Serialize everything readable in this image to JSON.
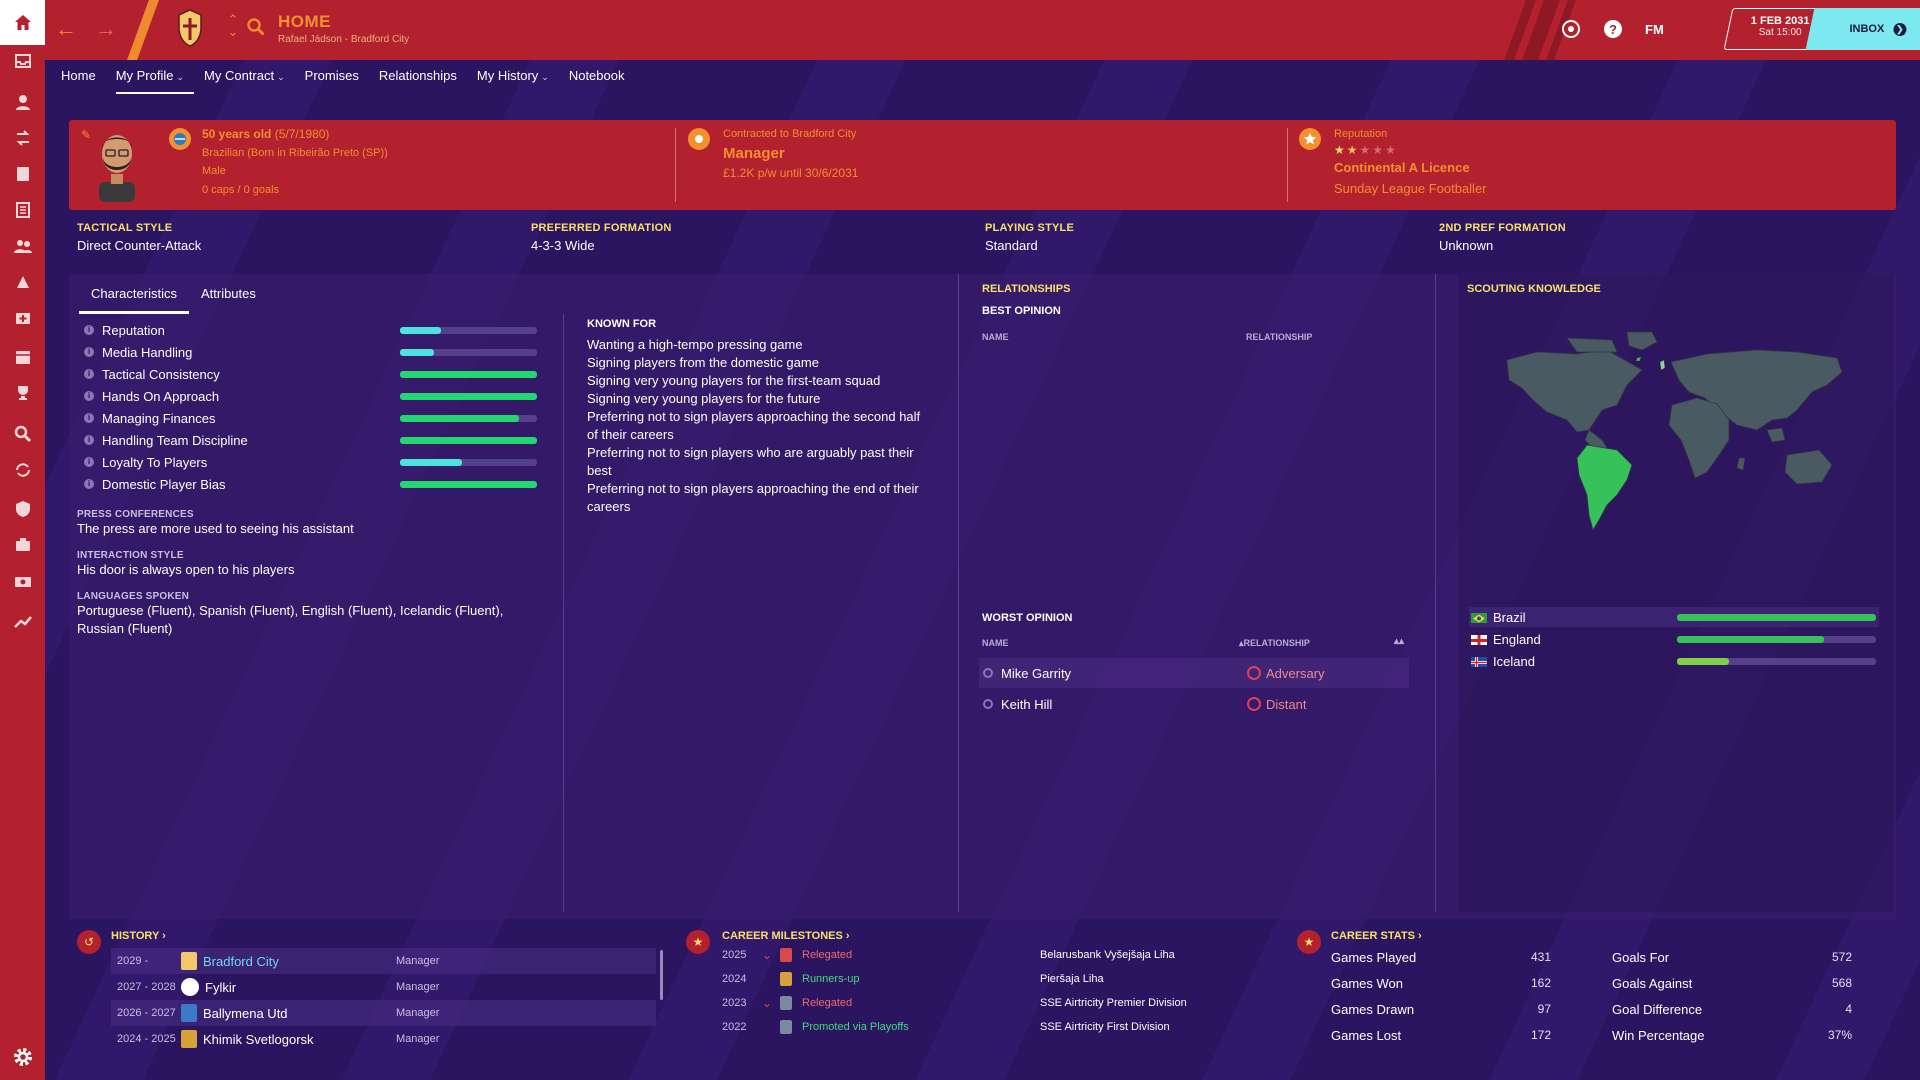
{
  "topbar": {
    "title": "HOME",
    "subtitle": "Rafael Jádson - Bradford City",
    "fm_label": "FM",
    "date": "1 FEB 2031",
    "time": "Sat 15:00",
    "inbox_label": "INBOX"
  },
  "tabs": [
    {
      "label": "Home",
      "has_menu": false
    },
    {
      "label": "My Profile",
      "has_menu": true,
      "active": true
    },
    {
      "label": "My Contract",
      "has_menu": true
    },
    {
      "label": "Promises",
      "has_menu": false
    },
    {
      "label": "Relationships",
      "has_menu": false
    },
    {
      "label": "My History",
      "has_menu": true
    },
    {
      "label": "Notebook",
      "has_menu": false
    }
  ],
  "profile": {
    "age": "50 years old",
    "dob": "(5/7/1980)",
    "nationality": "Brazilian (Born in Ribeirão Preto (SP))",
    "gender": "Male",
    "caps": "0 caps / 0 goals",
    "contract_label": "Contracted to Bradford City",
    "role": "Manager",
    "wage": "£1.2K p/w until 30/6/2031",
    "reputation_label": "Reputation",
    "reputation_stars": 1.5,
    "licence": "Continental A Licence",
    "playing_level": "Sunday League Footballer"
  },
  "properties": [
    {
      "label": "TACTICAL STYLE",
      "value": "Direct Counter-Attack"
    },
    {
      "label": "PREFERRED FORMATION",
      "value": "4-3-3 Wide"
    },
    {
      "label": "PLAYING STYLE",
      "value": "Standard"
    },
    {
      "label": "2ND PREF FORMATION",
      "value": "Unknown"
    }
  ],
  "subtabs": [
    "Characteristics",
    "Attributes"
  ],
  "characteristics": [
    {
      "label": "Reputation",
      "level": 0.3,
      "color": "#4ee3df"
    },
    {
      "label": "Media Handling",
      "level": 0.25,
      "color": "#4ee3df"
    },
    {
      "label": "Tactical Consistency",
      "level": 1.0,
      "color": "#23d670"
    },
    {
      "label": "Hands On Approach",
      "level": 1.0,
      "color": "#23d670"
    },
    {
      "label": "Managing Finances",
      "level": 0.87,
      "color": "#23d670"
    },
    {
      "label": "Handling Team Discipline",
      "level": 1.0,
      "color": "#23d670"
    },
    {
      "label": "Loyalty To Players",
      "level": 0.45,
      "color": "#4ee3df"
    },
    {
      "label": "Domestic Player Bias",
      "level": 1.0,
      "color": "#23d670"
    }
  ],
  "press": {
    "label": "PRESS CONFERENCES",
    "value": "The press are more used to seeing his assistant"
  },
  "interaction": {
    "label": "INTERACTION STYLE",
    "value": "His door is always open to his players"
  },
  "languages": {
    "label": "LANGUAGES SPOKEN",
    "line1": "Portuguese (Fluent), Spanish (Fluent), English (Fluent), Icelandic (Fluent),",
    "line2": "Russian (Fluent)"
  },
  "known_for": {
    "title": "KNOWN FOR",
    "lines": [
      "Wanting a high-tempo pressing game",
      "Signing players from the domestic game",
      "Signing very young players for the first-team squad",
      "Signing very young players for the future",
      "Preferring not to sign players approaching the second half",
      "of their careers",
      "Preferring not to sign players who are arguably past their",
      "best",
      "Preferring not to sign players approaching the end of their",
      "careers"
    ]
  },
  "relationships": {
    "title": "RELATIONSHIPS",
    "best_title": "BEST OPINION",
    "worst_title": "WORST OPINION",
    "col_name": "NAME",
    "col_relationship": "RELATIONSHIP",
    "worst": [
      {
        "name": "Mike Garrity",
        "relationship": "Adversary"
      },
      {
        "name": "Keith Hill",
        "relationship": "Distant"
      }
    ]
  },
  "scouting": {
    "title": "SCOUTING KNOWLEDGE",
    "countries": [
      {
        "name": "Brazil",
        "level": 1.0
      },
      {
        "name": "England",
        "level": 0.74
      },
      {
        "name": "Iceland",
        "level": 0.26
      }
    ]
  },
  "history": {
    "title": "HISTORY",
    "rows": [
      {
        "years": "2029 -",
        "club": "Bradford City",
        "role": "Manager",
        "current": true
      },
      {
        "years": "2027 - 2028",
        "club": "Fylkir",
        "role": "Manager"
      },
      {
        "years": "2026 - 2027",
        "club": "Ballymena Utd",
        "role": "Manager"
      },
      {
        "years": "2024 - 2025",
        "club": "Khimik Svetlogorsk",
        "role": "Manager"
      }
    ]
  },
  "milestones": {
    "title": "CAREER MILESTONES",
    "rows": [
      {
        "year": "2025",
        "result": "Relegated",
        "competition": "Belarusbank Vyšejšaja Liha",
        "type": "down"
      },
      {
        "year": "2024",
        "result": "Runners-up",
        "competition": "Pieršaja Liha",
        "type": "up"
      },
      {
        "year": "2023",
        "result": "Relegated",
        "competition": "SSE Airtricity Premier Division",
        "type": "down"
      },
      {
        "year": "2022",
        "result": "Promoted via Playoffs",
        "competition": "SSE Airtricity First Division",
        "type": "up"
      }
    ]
  },
  "career_stats": {
    "title": "CAREER STATS",
    "left": [
      {
        "label": "Games Played",
        "value": "431"
      },
      {
        "label": "Games Won",
        "value": "162"
      },
      {
        "label": "Games Drawn",
        "value": "97"
      },
      {
        "label": "Games Lost",
        "value": "172"
      }
    ],
    "right": [
      {
        "label": "Goals For",
        "value": "572"
      },
      {
        "label": "Goals Against",
        "value": "568"
      },
      {
        "label": "Goal Difference",
        "value": "4"
      },
      {
        "label": "Win Percentage",
        "value": "37%"
      }
    ]
  },
  "colors": {
    "accent": "#f3902f",
    "topbar": "#b3202e",
    "bg": "#2b1460",
    "highlight": "#f7e16a",
    "inbox": "#7ce8ef"
  }
}
